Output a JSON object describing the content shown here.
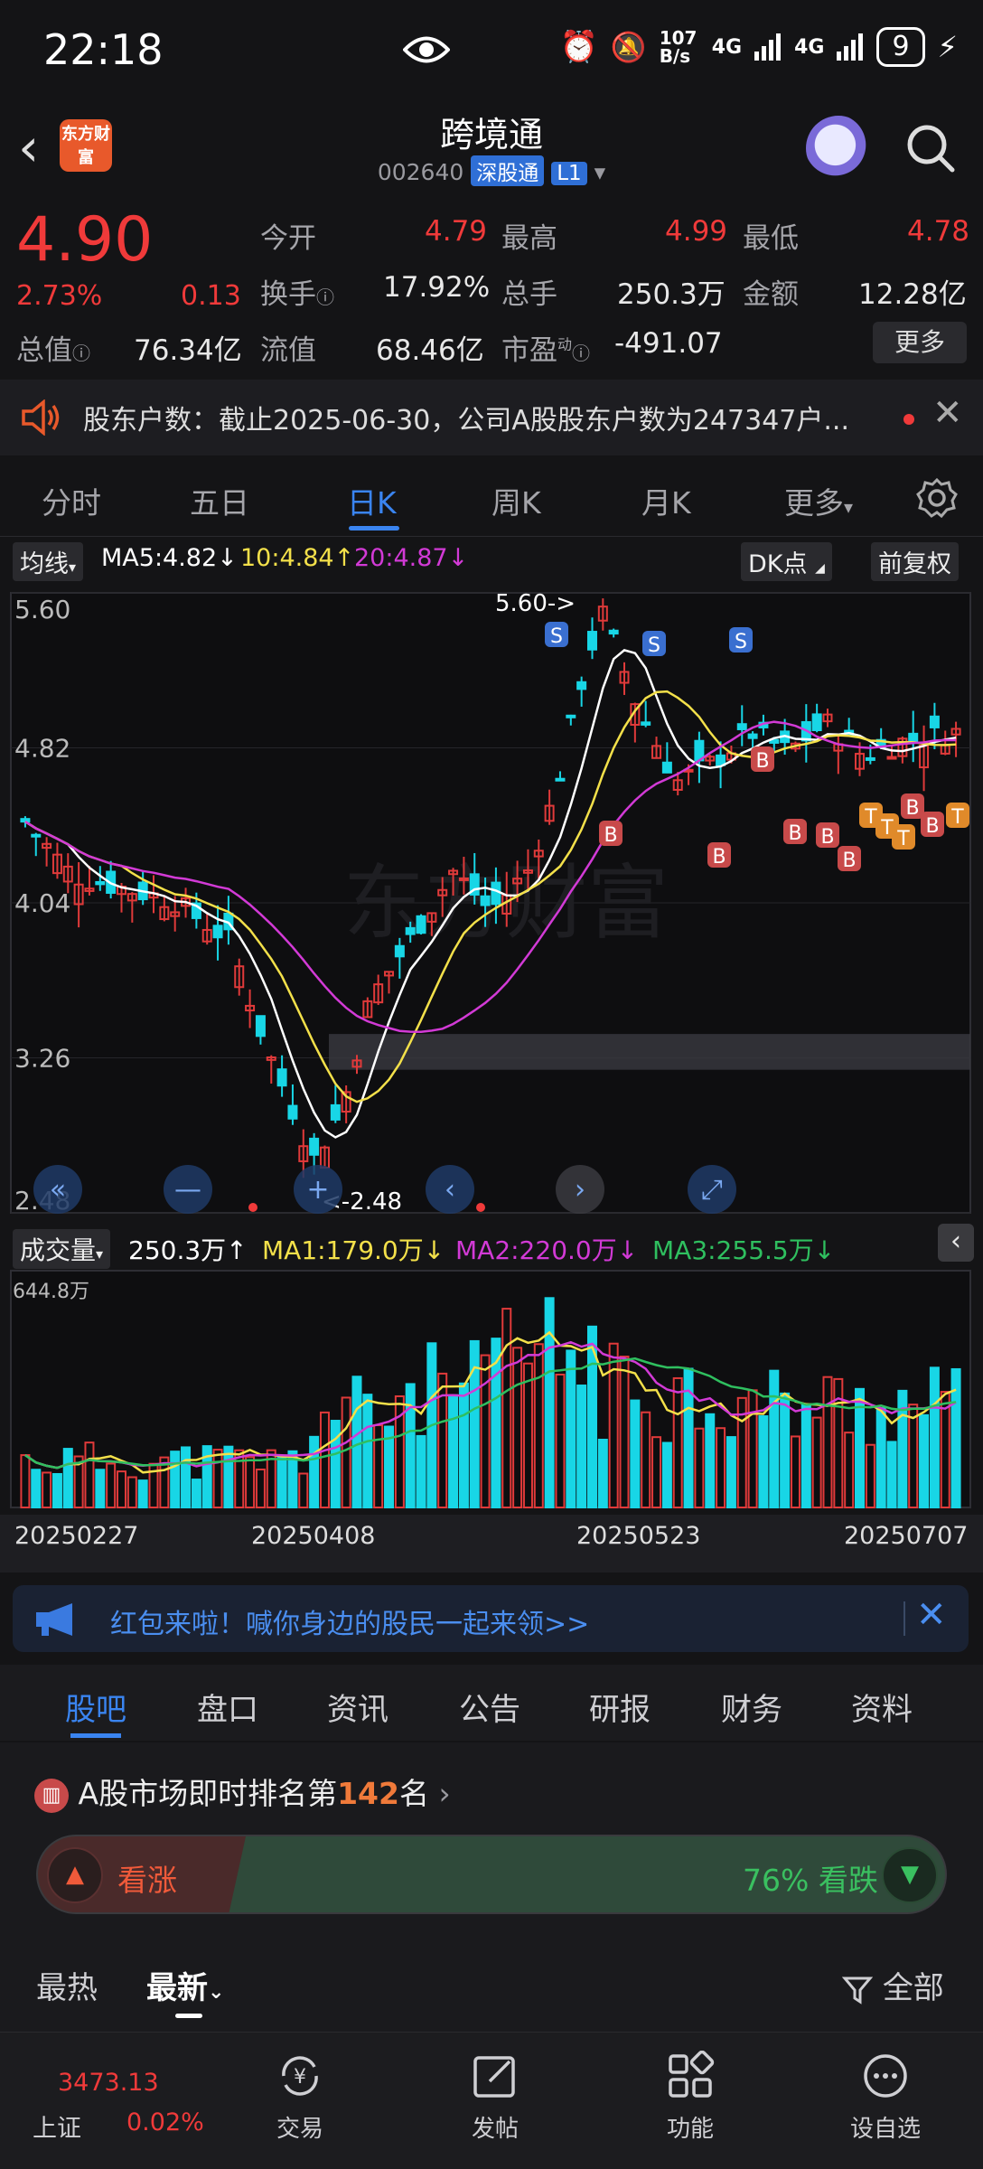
{
  "status": {
    "time": "22:18",
    "net_speed": "107 B/s",
    "signal1": "4G",
    "signal2": "4G",
    "battery": "9"
  },
  "header": {
    "brand_logo": "东方财富",
    "title": "跨境通",
    "code": "002640",
    "tag": "深股通",
    "level": "L1"
  },
  "quote": {
    "price": "4.90",
    "change_pct": "2.73%",
    "change": "0.13",
    "open_label": "今开",
    "open": "4.79",
    "high_label": "最高",
    "high": "4.99",
    "low_label": "最低",
    "low": "4.78",
    "turnover_label": "换手",
    "turnover": "17.92%",
    "volume_label": "总手",
    "volume": "250.3万",
    "amount_label": "金额",
    "amount": "12.28亿",
    "mktcap_label": "总值",
    "mktcap": "76.34亿",
    "float_label": "流值",
    "float": "68.46亿",
    "pe_label": "市盈",
    "pe_sup": "动",
    "pe": "-491.07",
    "more": "更多"
  },
  "notice": {
    "text": "股东户数：截止2025-06-30，公司A股股东户数为247347户..."
  },
  "period_tabs": [
    "分时",
    "五日",
    "日K",
    "周K",
    "月K",
    "更多"
  ],
  "kline_header": {
    "indicator": "均线",
    "ma5": "MA5:4.82",
    "ma10": "10:4.84",
    "ma20": "20:4.87",
    "dk": "DK点",
    "adjust": "前复权"
  },
  "chart_data": {
    "type": "candlestick",
    "ylim": [
      2.48,
      5.6
    ],
    "y_ticks": [
      "5.60",
      "4.82",
      "4.04",
      "3.26",
      "2.48"
    ],
    "annotations": {
      "high": "5.60->",
      "low": "<-2.48"
    },
    "x_ticks": [
      "20250227",
      "20250408",
      "20250523",
      "20250707"
    ],
    "volume": {
      "label": "成交量",
      "value": "250.3万",
      "ma1": "MA1:179.0万",
      "ma2": "MA2:220.0万",
      "ma3": "MA3:255.5万",
      "max_label": "644.8万"
    },
    "colors": {
      "up": "#e03a3a",
      "down": "#18d6e6",
      "ma5": "#ffffff",
      "ma10": "#f3e04a",
      "ma20": "#d23ad6",
      "vol_ma3": "#2fbf5f"
    }
  },
  "banner": {
    "text": "红包来啦！喊你身边的股民一起来领>>"
  },
  "section_tabs": [
    "股吧",
    "盘口",
    "资讯",
    "公告",
    "研报",
    "财务",
    "资料"
  ],
  "ranking": {
    "prefix": "A股市场即时排名第",
    "rank": "142",
    "suffix": "名",
    "up_label": "看涨",
    "down_label": "76% 看跌"
  },
  "feed": {
    "hot": "最热",
    "new": "最新",
    "filter": "全部"
  },
  "bottom_nav": {
    "index_value": "3473.13",
    "index_name": "上证",
    "index_change": "0.02%",
    "trade": "交易",
    "post": "发帖",
    "function": "功能",
    "watch": "设自选"
  }
}
